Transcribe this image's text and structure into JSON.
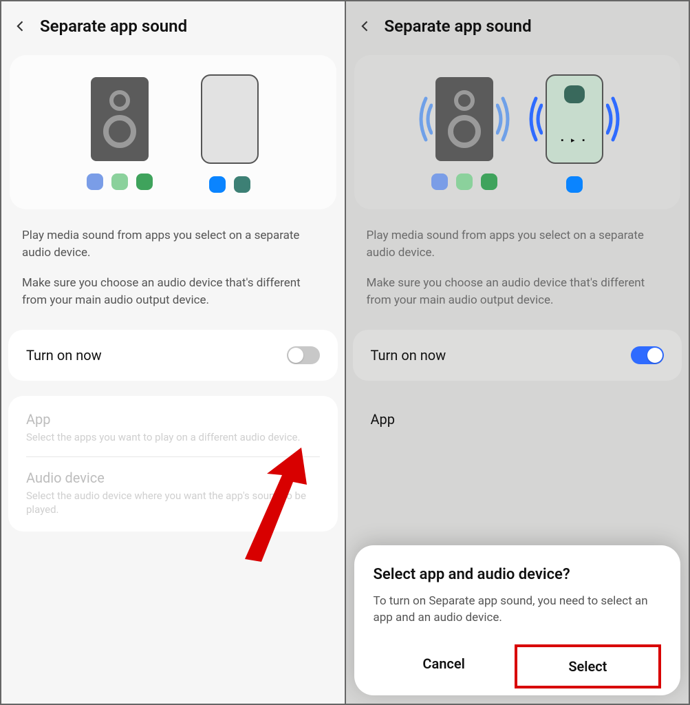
{
  "left": {
    "title": "Separate app sound",
    "desc1": "Play media sound from apps you select on a separate audio device.",
    "desc2": "Make sure you choose an audio device that's different from your main audio output device.",
    "turn_on_label": "Turn on now",
    "app_title": "App",
    "app_desc": "Select the apps you want to play on a different audio device.",
    "audio_title": "Audio device",
    "audio_desc": "Select the audio device where you want the app's sound to be played."
  },
  "right": {
    "title": "Separate app sound",
    "desc1": "Play media sound from apps you select on a separate audio device.",
    "desc2": "Make sure you choose an audio device that's different from your main audio output device.",
    "turn_on_label": "Turn on now",
    "app_title": "App"
  },
  "dialog": {
    "title": "Select app and audio device?",
    "body": "To turn on Separate app sound, you need to select an app and an audio device.",
    "cancel": "Cancel",
    "select": "Select"
  }
}
